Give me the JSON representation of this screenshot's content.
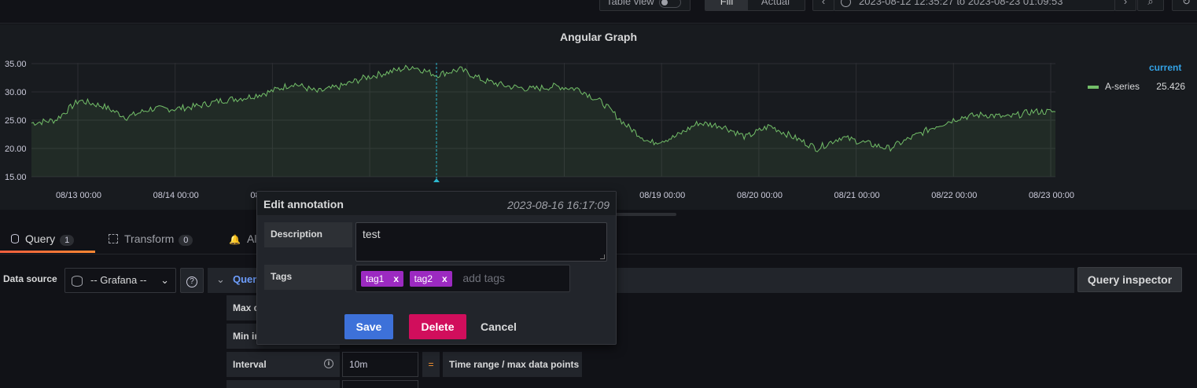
{
  "toolbar": {
    "table_view_label": "Table view",
    "fill_label": "Fill",
    "actual_label": "Actual",
    "time_range": "2023-08-12 12:35:27 to 2023-08-23 01:09:53"
  },
  "panel": {
    "title": "Angular Graph"
  },
  "legend": {
    "header": "current",
    "series": [
      {
        "name": "A-series",
        "value": "25.426",
        "color": "#73bf69"
      }
    ]
  },
  "chart_data": {
    "type": "area",
    "title": "Angular Graph",
    "y_ticks": [
      "35.00",
      "30.00",
      "25.00",
      "20.00",
      "15.00"
    ],
    "ylim": [
      15,
      37
    ],
    "x_ticks": [
      "08/13 00:00",
      "08/14 00:00",
      "08/15 00:00",
      "08/16 00:00",
      "08/17 00:00",
      "08/18 00:00",
      "08/19 00:00",
      "08/20 00:00",
      "08/21 00:00",
      "08/22 00:00",
      "08/23 00:00"
    ],
    "grid": true,
    "series": [
      {
        "name": "A-series",
        "color": "#73bf69",
        "x_days": [
          0,
          0.25,
          0.5,
          0.75,
          1,
          1.25,
          1.5,
          1.75,
          2,
          2.25,
          2.5,
          2.75,
          3,
          3.25,
          3.5,
          3.75,
          4,
          4.25,
          4.5,
          4.75,
          5,
          5.25,
          5.5,
          5.75,
          6,
          6.25,
          6.5,
          6.75,
          7,
          7.25,
          7.5,
          7.75,
          8,
          8.25,
          8.5,
          8.75,
          9,
          9.25,
          9.5,
          9.75,
          10,
          10.25,
          10.5,
          10.75
        ],
        "values": [
          24.5,
          25,
          28.5,
          27.5,
          25.5,
          27,
          27,
          27.5,
          28.5,
          29,
          30,
          31.5,
          30,
          31,
          32.5,
          33.5,
          34.5,
          33,
          34,
          32,
          31,
          30.5,
          31,
          30.5,
          28,
          24,
          21,
          22,
          24.5,
          24,
          22,
          24,
          22,
          20,
          22,
          21,
          20,
          22,
          24,
          25.5,
          26,
          25.5,
          26.5,
          26.5
        ]
      }
    ],
    "annotation": {
      "time": "2023-08-16 16:17:09",
      "description": "test",
      "tags": [
        "tag1",
        "tag2"
      ]
    }
  },
  "editor": {
    "tabs": [
      {
        "label": "Query",
        "count": "1"
      },
      {
        "label": "Transform",
        "count": "0"
      },
      {
        "label": "Al"
      }
    ],
    "datasource_label": "Data source",
    "datasource_value": "-- Grafana --",
    "help_glyph": "?",
    "query_title": "Quer",
    "query_inspector": "Query inspector",
    "options": [
      {
        "label": "Max d"
      },
      {
        "label": "Min in"
      },
      {
        "label": "Interval",
        "value": "10m",
        "eq": "=",
        "note": "Time range / max data points"
      }
    ]
  },
  "annotation_modal": {
    "title": "Edit annotation",
    "time": "2023-08-16 16:17:09",
    "description_label": "Description",
    "description_value": "test",
    "tags_label": "Tags",
    "tags": [
      {
        "label": "tag1",
        "remove": "x"
      },
      {
        "label": "tag2",
        "remove": "x"
      }
    ],
    "tags_placeholder": "add tags",
    "save": "Save",
    "delete": "Delete",
    "cancel": "Cancel"
  }
}
